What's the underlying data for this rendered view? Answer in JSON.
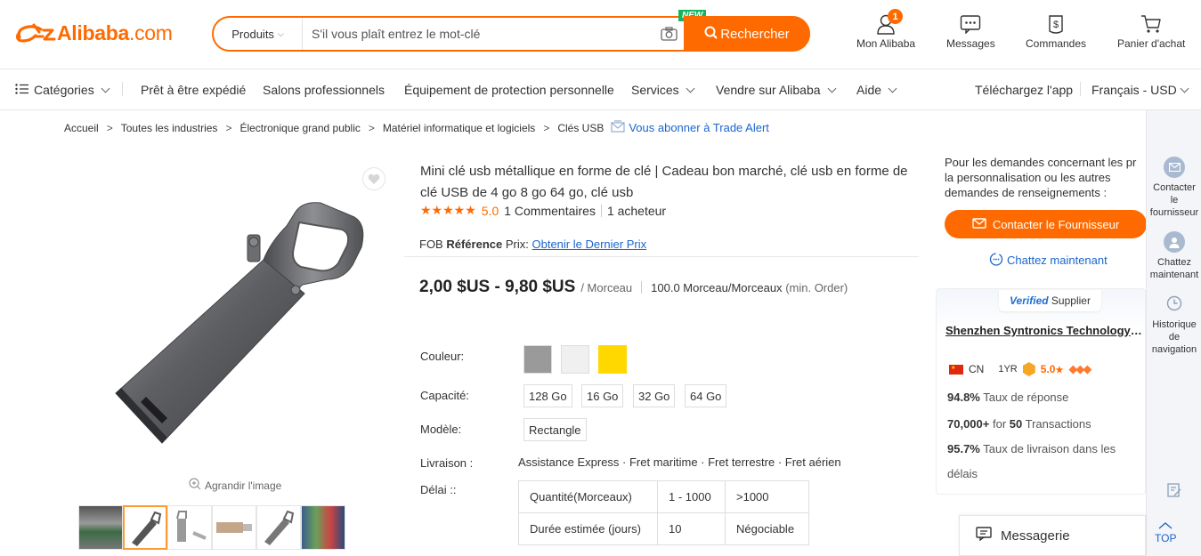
{
  "header": {
    "logo_main": "Alibaba",
    "logo_suffix": ".com",
    "search_category": "Produits",
    "search_placeholder": "S'il vous plaît entrez le mot-clé",
    "new_badge": "NEW",
    "search_button": "Rechercher",
    "nav": [
      {
        "label": "Mon Alibaba",
        "icon": "user-icon",
        "badge": "1"
      },
      {
        "label": "Messages",
        "icon": "message-icon"
      },
      {
        "label": "Commandes",
        "icon": "orders-icon"
      },
      {
        "label": "Panier d'achat",
        "icon": "cart-icon"
      }
    ]
  },
  "navbar": {
    "categories": "Catégories",
    "items": [
      "Prêt à être expédié",
      "Salons professionnels",
      "Équipement de protection personnelle",
      "Services",
      "Vendre sur Alibaba",
      "Aide"
    ],
    "app": "Téléchargez l'app",
    "locale": "Français - USD"
  },
  "breadcrumb": {
    "items": [
      "Accueil",
      "Toutes les industries",
      "Électronique grand public",
      "Matériel informatique et logiciels",
      "Clés USB"
    ],
    "trade_alert": "Vous abonner à Trade Alert"
  },
  "gallery": {
    "zoom_label": "Agrandir l'image",
    "thumb_count": 6,
    "active_thumb": 2
  },
  "product": {
    "title": "Mini clé usb métallique en forme de clé | Cadeau bon marché, clé usb en forme de clé USB de 4 go 8 go 64 go, clé usb",
    "stars": "★★★★★",
    "rating": "5.0",
    "reviews": "1 Commentaires",
    "buyers": "1 acheteur",
    "fob_prefix": "FOB",
    "fob_ref": "Référence",
    "fob_prix": "Prix:",
    "fob_link": "Obtenir le Dernier Prix",
    "price": "2,00 $US - 9,80 $US",
    "price_unit": "/ Morceau",
    "moq_value": "100.0 Morceau/Morceaux",
    "moq_label": "(min. Order)",
    "color_label": "Couleur:",
    "colors": [
      "#9a9a9a",
      "#f0f0f0",
      "#ffd800"
    ],
    "capacity_label": "Capacité:",
    "capacities": [
      "128 Go",
      "16 Go",
      "32 Go",
      "64 Go"
    ],
    "model_label": "Modèle:",
    "model": "Rectangle",
    "shipping_label": "Livraison :",
    "shipping": "Assistance Express · Fret maritime · Fret terrestre · Fret aérien",
    "lead_label": "Délai ::",
    "lead_table": {
      "headers": [
        "Quantité(Morceaux)",
        "1 - 1000",
        ">1000"
      ],
      "row": [
        "Durée estimée (jours)",
        "10",
        "Négociable"
      ]
    }
  },
  "supplier": {
    "intro": [
      "Pour les demandes concernant les pr",
      "la personnalisation ou les autres",
      "demandes de renseignements :"
    ],
    "contact_button": "Contacter le Fournisseur",
    "chat_now": "Chattez maintenant",
    "verified_word": "Verified",
    "verified_rest": "Supplier",
    "name": "Shenzhen Syntronics Technology ...",
    "country": "CN",
    "years": "1YR",
    "score": "5.0",
    "score_star": "★",
    "response_rate": "94.8%",
    "response_label": "Taux de réponse",
    "transactions_amount": "70,000+",
    "transactions_for": "for",
    "transactions_count": "50",
    "transactions_label": "Transactions",
    "delivery_rate": "95.7%",
    "delivery_label_1": "Taux de livraison dans les",
    "delivery_label_2": "délais"
  },
  "sidebar": {
    "contact": [
      "Contacter",
      "le",
      "fournisseur"
    ],
    "chat": [
      "Chattez",
      "maintenant"
    ],
    "history": [
      "Historique",
      "de",
      "navigation"
    ],
    "top": "TOP"
  },
  "messagerie": "Messagerie",
  "colors": {
    "accent": "#ff6a00",
    "link": "#1a66cc",
    "verified": "#1f6ed4"
  }
}
